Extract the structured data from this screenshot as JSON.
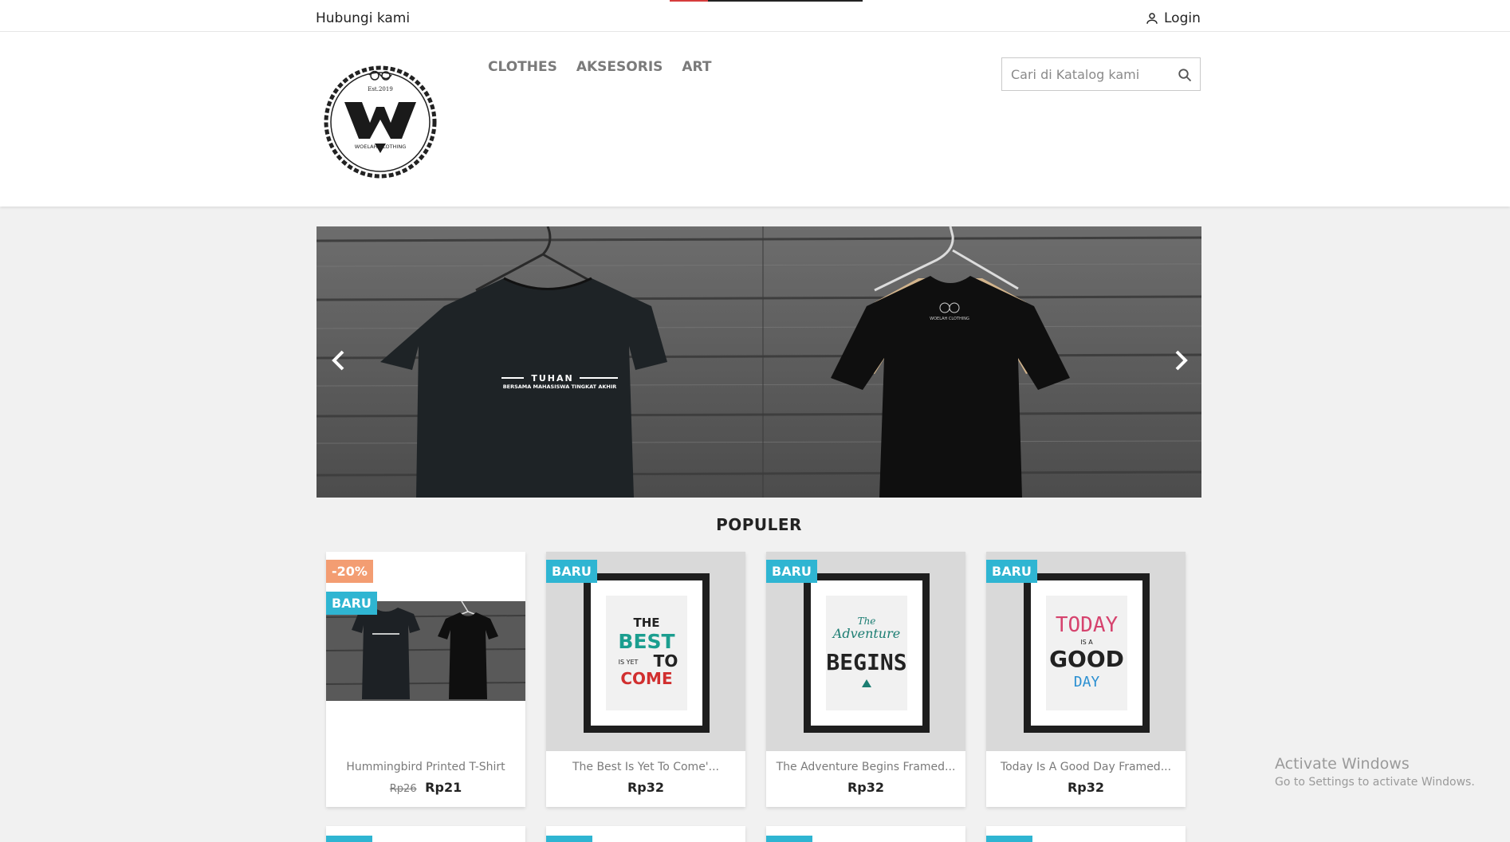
{
  "topbar": {
    "contact_label": "Hubungi kami",
    "login_label": "Login"
  },
  "header": {
    "logo_text": "WOELAH CLOTHING",
    "logo_est": "Est.2019",
    "nav": [
      "CLOTHES",
      "AKSESORIS",
      "ART"
    ],
    "search_placeholder": "Cari di Katalog kami"
  },
  "slider": {
    "shirt1_line1": "TUHAN",
    "shirt1_line2": "BERSAMA MAHASISWA TINGKAT AKHIR",
    "shirt2_logo": "WOELAH CLOTHING"
  },
  "section_title": "POPULER",
  "products": [
    {
      "name": "Hummingbird Printed T-Shirt",
      "old_price": "Rp26",
      "price": "Rp21",
      "discount": "-20%",
      "badge": "BARU"
    },
    {
      "name": "The Best Is Yet To Come'...",
      "price": "Rp32",
      "badge": "BARU",
      "art": [
        "THE",
        "BEST",
        "IS YET",
        "TO",
        "COME"
      ]
    },
    {
      "name": "The Adventure Begins Framed...",
      "price": "Rp32",
      "badge": "BARU",
      "art": [
        "The",
        "Adventure",
        "BEGINS"
      ]
    },
    {
      "name": "Today Is A Good Day Framed...",
      "price": "Rp32",
      "badge": "BARU",
      "art": [
        "TODAY",
        "IS A",
        "GOOD",
        "DAY"
      ]
    }
  ],
  "windows_notice": {
    "title": "Activate Windows",
    "subtitle": "Go to Settings to activate Windows."
  },
  "colors": {
    "accent": "#2fb5d2",
    "discount": "#f39d72",
    "text": "#232323",
    "muted": "#7a7a7a"
  }
}
